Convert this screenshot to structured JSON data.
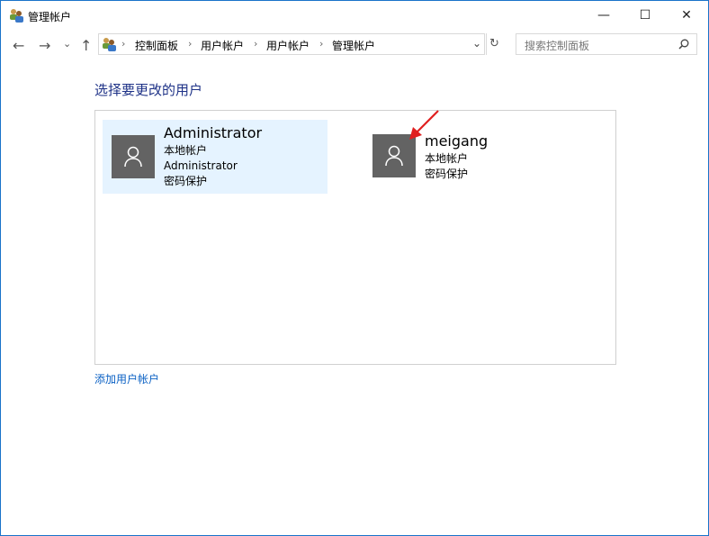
{
  "window": {
    "title": "管理帐户",
    "minimize": "—",
    "maximize": "☐",
    "close": "✕"
  },
  "nav": {
    "back": "←",
    "forward": "→",
    "recent": "⌄",
    "up": "↑",
    "refresh": "↻"
  },
  "breadcrumb": [
    "控制面板",
    "用户帐户",
    "用户帐户",
    "管理帐户"
  ],
  "search": {
    "placeholder": "搜索控制面板"
  },
  "main": {
    "heading": "选择要更改的用户",
    "accounts": [
      {
        "name": "Administrator",
        "lines": [
          "本地帐户",
          "Administrator",
          "密码保护"
        ],
        "selected": true
      },
      {
        "name": "meigang",
        "lines": [
          "本地帐户",
          "密码保护"
        ],
        "selected": false
      }
    ],
    "add_link": "添加用户帐户"
  },
  "colors": {
    "selected_bg": "#e5f3ff",
    "avatar": "#636363",
    "link": "#0b61c4",
    "heading": "#1e3287",
    "arrow": "#e02020"
  }
}
